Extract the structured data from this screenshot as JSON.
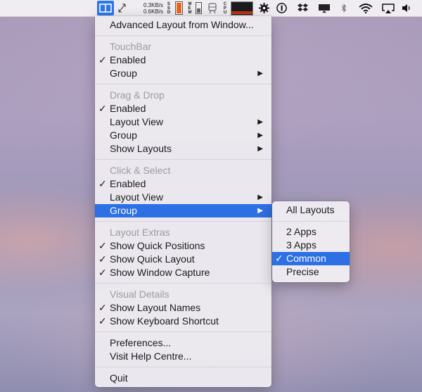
{
  "menubar": {
    "net_up": "0.3KB/s",
    "net_down": "0.6KB/s",
    "ssd_label": "S\nS\nD",
    "mem_label": "M\nE\nM",
    "cpu_label": "C\nP\nU",
    "accent_color": "#2f77e6",
    "icons": [
      "layout-app-icon",
      "resize-icon",
      "battery-gauge-icon",
      "memory-chip-icon",
      "network-train-icon",
      "cpu-graph-icon",
      "gear-icon",
      "password-icon",
      "dropbox-icon",
      "display-icon",
      "bluetooth-icon",
      "wifi-icon",
      "airplay-icon",
      "volume-icon"
    ]
  },
  "menu": {
    "advanced": "Advanced Layout from Window...",
    "touchbar": {
      "header": "TouchBar",
      "enabled": "Enabled",
      "group": "Group"
    },
    "dragdrop": {
      "header": "Drag & Drop",
      "enabled": "Enabled",
      "layout_view": "Layout View",
      "group": "Group",
      "show_layouts": "Show Layouts"
    },
    "clickselect": {
      "header": "Click & Select",
      "enabled": "Enabled",
      "layout_view": "Layout View",
      "group": "Group"
    },
    "extras": {
      "header": "Layout Extras",
      "quick_positions": "Show Quick Positions",
      "quick_layout": "Show Quick Layout",
      "window_capture": "Show Window Capture"
    },
    "visual": {
      "header": "Visual Details",
      "layout_names": "Show Layout Names",
      "keyboard_shortcut": "Show Keyboard Shortcut"
    },
    "preferences": "Preferences...",
    "help": "Visit Help Centre...",
    "quit": "Quit",
    "check_glyph": "✓",
    "arrow_glyph": "▶"
  },
  "submenu": {
    "all_layouts": "All Layouts",
    "two_apps": "2 Apps",
    "three_apps": "3 Apps",
    "common": "Common",
    "precise": "Precise"
  }
}
